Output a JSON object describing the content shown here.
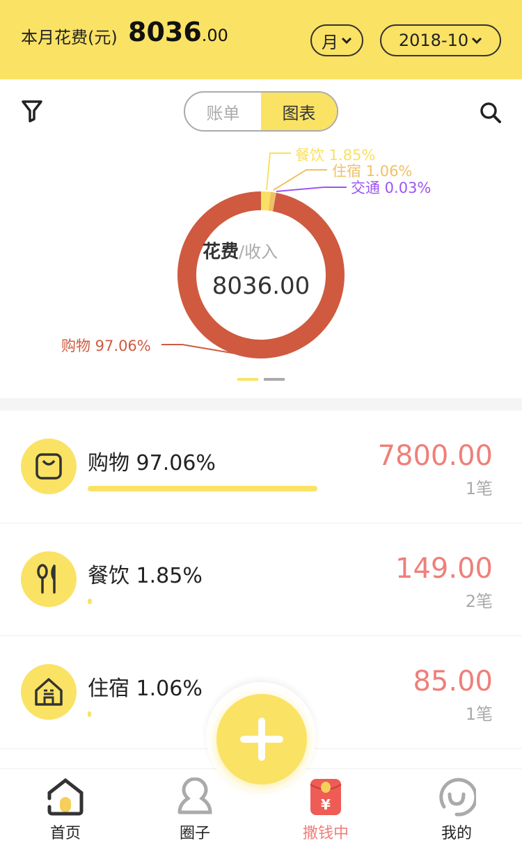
{
  "header": {
    "label": "本月花费(元)",
    "amount_int": "8036",
    "amount_dec": ".00",
    "period_select": "月",
    "month_select": "2018-10"
  },
  "toolbar": {
    "tabs": [
      {
        "label": "账单",
        "active": false
      },
      {
        "label": "图表",
        "active": true
      }
    ]
  },
  "chart_data": {
    "type": "pie",
    "donut": true,
    "center_title": "花费",
    "center_subtitle": "/收入",
    "center_value": "8036.00",
    "slices": [
      {
        "name": "餐饮",
        "percent": 1.85,
        "label": "餐饮 1.85%",
        "color": "#f9e063"
      },
      {
        "name": "住宿",
        "percent": 1.06,
        "label": "住宿 1.06%",
        "color": "#f0c164"
      },
      {
        "name": "交通",
        "percent": 0.03,
        "label": "交通 0.03%",
        "color": "#9b55f2"
      },
      {
        "name": "购物",
        "percent": 97.06,
        "label": "购物 97.06%",
        "color": "#cf5a3f"
      }
    ]
  },
  "categories": [
    {
      "name": "购物 97.06%",
      "amount": "7800.00",
      "count": "1笔",
      "percent": 97.06,
      "icon": "shopping-bag-icon"
    },
    {
      "name": "餐饮 1.85%",
      "amount": "149.00",
      "count": "2笔",
      "percent": 1.85,
      "icon": "utensils-icon"
    },
    {
      "name": "住宿 1.06%",
      "amount": "85.00",
      "count": "1笔",
      "percent": 1.06,
      "icon": "house-icon"
    }
  ],
  "tabbar": [
    {
      "label": "首页",
      "icon": "home-icon",
      "color": "#222"
    },
    {
      "label": "圈子",
      "icon": "person-icon",
      "color": "#222"
    },
    {
      "label": "撒钱中",
      "icon": "red-envelope-icon",
      "color": "#ef7f7a"
    },
    {
      "label": "我的",
      "icon": "smile-icon",
      "color": "#222"
    }
  ],
  "colors": {
    "accent": "#fae265",
    "amount": "#ef7f7a"
  }
}
